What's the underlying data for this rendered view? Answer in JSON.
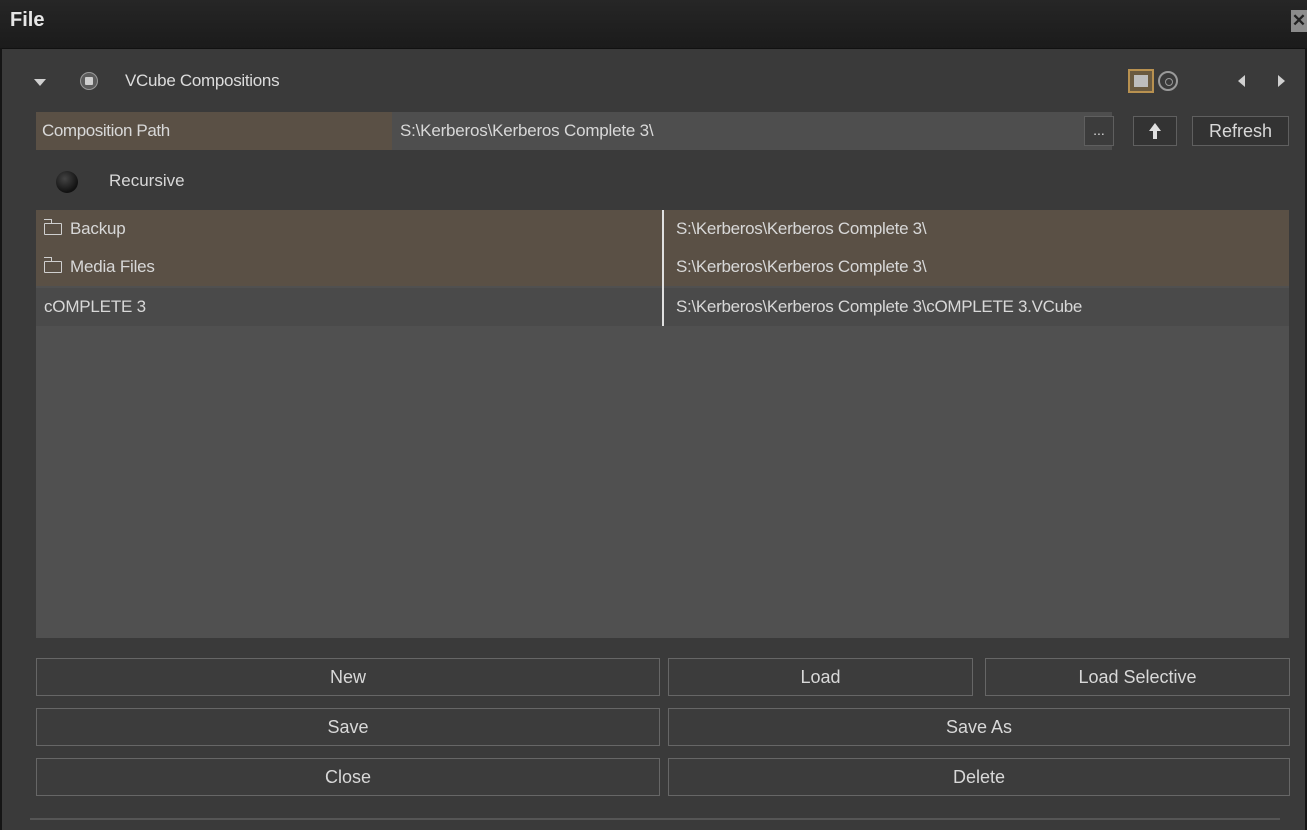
{
  "window": {
    "title": "File",
    "close_label": "✕"
  },
  "section": {
    "title": "VCube Compositions"
  },
  "path_row": {
    "label": "Composition Path",
    "value": "S:\\Kerberos\\Kerberos Complete 3\\",
    "browse_label": "...",
    "refresh_label": "Refresh"
  },
  "recursive": {
    "label": "Recursive"
  },
  "file_list": [
    {
      "name": "Backup",
      "path": "S:\\Kerberos\\Kerberos Complete 3\\",
      "type": "folder"
    },
    {
      "name": "Media Files",
      "path": "S:\\Kerberos\\Kerberos Complete 3\\",
      "type": "folder"
    },
    {
      "name": "cOMPLETE 3",
      "path": "S:\\Kerberos\\Kerberos Complete 3\\cOMPLETE 3.VCube",
      "type": "file"
    }
  ],
  "buttons": {
    "new": "New",
    "load": "Load",
    "load_selective": "Load Selective",
    "save": "Save",
    "save_as": "Save As",
    "close": "Close",
    "delete": "Delete"
  },
  "colors": {
    "background": "#3a3a3a",
    "folder_row": "#5a5045",
    "file_row": "#4a4a4a",
    "accent": "#b89150"
  },
  "icons": [
    "collapse-triangle-icon",
    "stop-icon",
    "view-icon",
    "gear-icon",
    "prev-arrow-icon",
    "next-arrow-icon",
    "folder-icon",
    "up-arrow-icon",
    "recording-dot-icon",
    "close-icon"
  ]
}
